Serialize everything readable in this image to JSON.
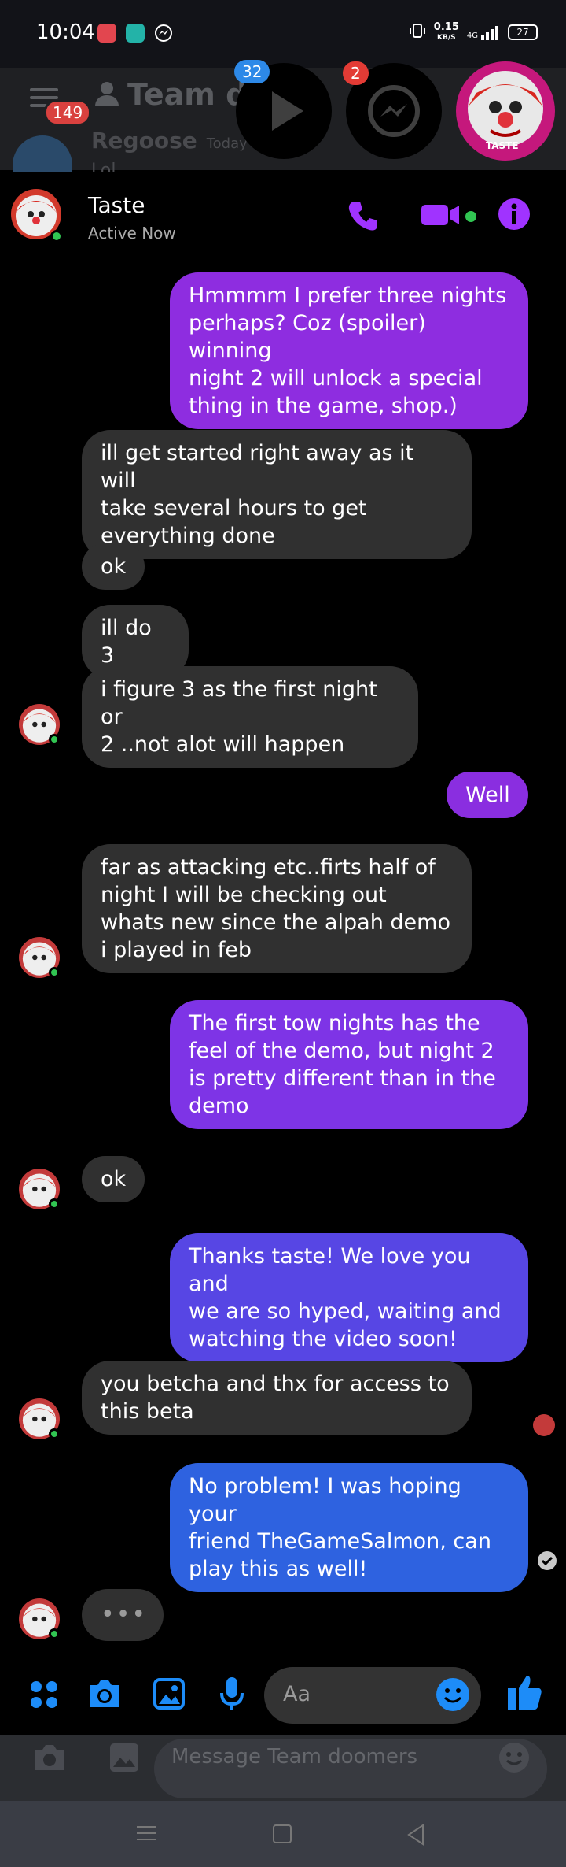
{
  "status_bar": {
    "time": "10:04",
    "speed_value": "0.15",
    "speed_unit": "KB/S",
    "network": "4G",
    "battery": "27"
  },
  "background_app": {
    "notification_count": "149",
    "channel_title": "Team d",
    "last_user": "Regoose",
    "last_time": "Today a",
    "last_preview": "Lol",
    "message_placeholder": "Message Team doomers"
  },
  "chat_heads": [
    {
      "name": "play",
      "badge": "32"
    },
    {
      "name": "messenger",
      "badge": "2"
    },
    {
      "name": "taste",
      "caption": "TASTE"
    }
  ],
  "conversation": {
    "name": "Taste",
    "status": "Active Now"
  },
  "colors": {
    "accent": "#a033ff",
    "incoming": "#303030",
    "online": "#31c552",
    "icon_blue": "#1d8cf8"
  },
  "messages": [
    {
      "dir": "out",
      "text": "Hmmmm I prefer three nights\nperhaps? Coz (spoiler) winning\nnight 2 will unlock a special\nthing in the game, shop.)",
      "color": "#8e2de0"
    },
    {
      "dir": "in",
      "text": "ill get started right away as it will\ntake several hours to get\neverything done"
    },
    {
      "dir": "in",
      "text": "ok"
    },
    {
      "dir": "in",
      "text": "ill do 3"
    },
    {
      "dir": "in",
      "text": "i figure 3 as the first night or\n2 ..not alot will happen"
    },
    {
      "dir": "out",
      "text": "Well",
      "color": "#8a2ee0"
    },
    {
      "dir": "in",
      "text": "far as attacking etc..firts half of\nnight  I  will be checking out\nwhats new since the alpah demo\ni played in feb"
    },
    {
      "dir": "out",
      "text": "The first tow nights has the\nfeel of the demo, but night 2\nis pretty different than in the\ndemo",
      "color": "#7e34e6"
    },
    {
      "dir": "in",
      "text": "ok"
    },
    {
      "dir": "out",
      "text": "Thanks taste! We love you and\nwe are so hyped, waiting and\nwatching the video soon!",
      "color": "#5746e4"
    },
    {
      "dir": "in",
      "text": "you betcha and thx for access to\nthis beta"
    },
    {
      "dir": "out",
      "text": "No problem! I was hoping your\nfriend TheGameSalmon, can\nplay this as well!",
      "color": "#2e62e0"
    }
  ],
  "typing_indicator": "•••",
  "composer": {
    "placeholder": "Aa"
  }
}
